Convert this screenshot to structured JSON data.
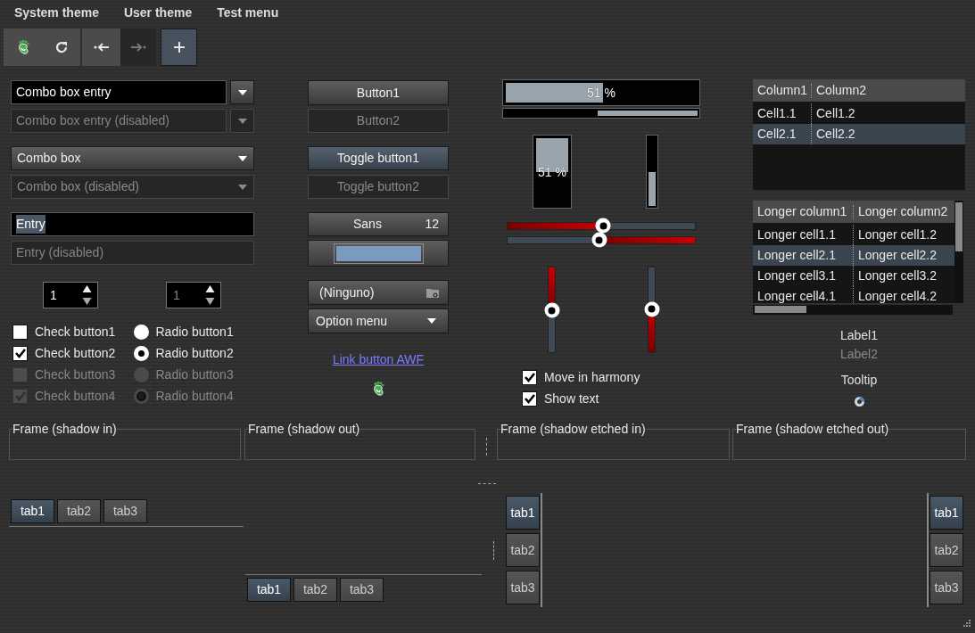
{
  "menu": [
    {
      "label": "System theme"
    },
    {
      "label": "User theme"
    },
    {
      "label": "Test menu"
    }
  ],
  "toolbar": [
    {
      "items": [
        {
          "kind": "footprint",
          "disabled": false,
          "active": false
        },
        {
          "kind": "refresh",
          "disabled": false,
          "active": false
        }
      ]
    },
    {
      "items": [
        {
          "kind": "back",
          "disabled": false,
          "active": false
        },
        {
          "kind": "forward",
          "disabled": true,
          "active": false
        }
      ]
    },
    {
      "items": [
        {
          "kind": "add",
          "disabled": false,
          "active": true
        }
      ]
    }
  ],
  "combo_box_entries": [
    {
      "value": "Combo box entry",
      "disabled": false
    },
    {
      "value": "Combo box entry (disabled)",
      "disabled": true
    }
  ],
  "combo_boxes": [
    {
      "value": "Combo box",
      "disabled": false
    },
    {
      "value": "Combo box (disabled)",
      "disabled": true
    }
  ],
  "entries": [
    {
      "value": "Entry",
      "disabled": false,
      "text_selected": true
    },
    {
      "value": "Entry (disabled)",
      "disabled": true,
      "text_selected": false
    }
  ],
  "spin_buttons": [
    {
      "value": "1",
      "disabled": false
    },
    {
      "value": "1",
      "disabled": true
    }
  ],
  "check_buttons": [
    {
      "label": "Check button1",
      "checked": false,
      "disabled": false
    },
    {
      "label": "Check button2",
      "checked": true,
      "disabled": false
    },
    {
      "label": "Check button3",
      "checked": false,
      "disabled": true
    },
    {
      "label": "Check button4",
      "checked": true,
      "disabled": true
    }
  ],
  "radio_buttons": [
    {
      "label": "Radio button1",
      "selected": false,
      "disabled": false
    },
    {
      "label": "Radio button2",
      "selected": true,
      "disabled": false
    },
    {
      "label": "Radio button3",
      "selected": false,
      "disabled": true
    },
    {
      "label": "Radio button4",
      "selected": true,
      "disabled": true
    }
  ],
  "buttons": [
    {
      "label": "Button1",
      "disabled": false
    },
    {
      "label": "Button2",
      "disabled": true
    }
  ],
  "toggle_buttons": [
    {
      "label": "Toggle button1",
      "active": true,
      "disabled": false
    },
    {
      "label": "Toggle button2",
      "active": false,
      "disabled": true
    }
  ],
  "font_button": {
    "font": "Sans",
    "size": "12"
  },
  "color_button": {
    "color": "#7b9ac0"
  },
  "file_chooser": {
    "label": "(Ninguno)"
  },
  "option_menu": {
    "label": "Option menu"
  },
  "link_button": {
    "label": "Link button AWF"
  },
  "horizontal_progress_bars": [
    {
      "level": 0.51,
      "text": "51 %",
      "inverted": false
    },
    {
      "level": 0.52,
      "inverted": true
    }
  ],
  "vertical_progress_bars": [
    {
      "level": 0.51,
      "text": "51 %",
      "inverted": false
    },
    {
      "level": 0.5,
      "inverted": true
    }
  ],
  "horizontal_sliders": [
    {
      "level": 0.51,
      "inverted": false
    },
    {
      "level": 0.49,
      "inverted": true
    }
  ],
  "vertical_sliders": [
    {
      "level": 0.51,
      "inverted": false
    },
    {
      "level": 0.49,
      "inverted": true
    }
  ],
  "harmony_checks": [
    {
      "label": "Move in harmony",
      "checked": true
    },
    {
      "label": "Show text",
      "checked": true
    }
  ],
  "tree_views": [
    {
      "columns": [
        "Column1",
        "Column2"
      ],
      "rows": [
        {
          "cells": [
            "Cell1.1",
            "Cell1.2"
          ],
          "selected": false
        },
        {
          "cells": [
            "Cell2.1",
            "Cell2.2"
          ],
          "selected": true
        }
      ]
    },
    {
      "columns": [
        "Longer column1",
        "Longer column2"
      ],
      "rows": [
        {
          "cells": [
            "Longer cell1.1",
            "Longer cell1.2"
          ],
          "selected": false
        },
        {
          "cells": [
            "Longer cell2.1",
            "Longer cell2.2"
          ],
          "selected": true
        },
        {
          "cells": [
            "Longer cell3.1",
            "Longer cell3.2"
          ],
          "selected": false
        },
        {
          "cells": [
            "Longer cell4.1",
            "Longer cell4.2"
          ],
          "selected": false
        }
      ]
    }
  ],
  "labels": [
    {
      "text": "Label1",
      "disabled": false
    },
    {
      "text": "Label2",
      "disabled": true
    }
  ],
  "tooltip_label": "Tooltip",
  "frames": [
    {
      "label": "Frame (shadow in)"
    },
    {
      "label": "Frame (shadow out)"
    },
    {
      "label": "Frame (shadow etched in)"
    },
    {
      "label": "Frame (shadow etched out)"
    }
  ],
  "notebooks": [
    {
      "kind": "top",
      "tabs": [
        {
          "label": "tab1",
          "selected": true
        },
        {
          "label": "tab2",
          "selected": false
        },
        {
          "label": "tab3",
          "selected": false
        }
      ]
    },
    {
      "kind": "bottom",
      "tabs": [
        {
          "label": "tab1",
          "selected": true
        },
        {
          "label": "tab2",
          "selected": false
        },
        {
          "label": "tab3",
          "selected": false
        }
      ]
    },
    {
      "kind": "left",
      "tabs": [
        {
          "label": "tab1",
          "selected": true
        },
        {
          "label": "tab2",
          "selected": false
        },
        {
          "label": "tab3",
          "selected": false
        }
      ]
    },
    {
      "kind": "right",
      "tabs": [
        {
          "label": "tab1",
          "selected": true
        },
        {
          "label": "tab2",
          "selected": false
        },
        {
          "label": "tab3",
          "selected": false
        }
      ]
    }
  ]
}
